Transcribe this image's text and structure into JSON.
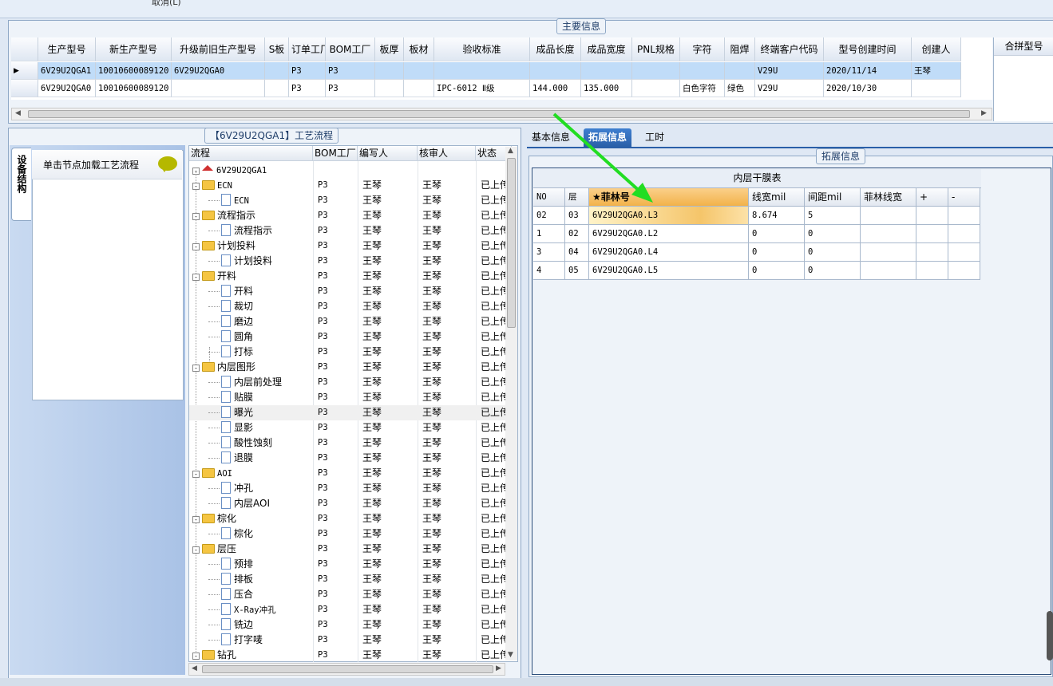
{
  "toolbar": {
    "cut_label": "取消(L)"
  },
  "main_info": {
    "title": "主要信息",
    "columns": [
      "生产型号",
      "新生产型号",
      "升级前旧生产型号",
      "S板",
      "订单工厂",
      "BOM工厂",
      "板厚",
      "板材",
      "验收标准",
      "成品长度",
      "成品宽度",
      "PNL规格",
      "字符",
      "阻焊",
      "终端客户代码",
      "型号创建时间",
      "创建人"
    ],
    "rows": [
      {
        "selected": true,
        "cells": [
          "6V29U2QGA1",
          "10010600089120",
          "6V29U2QGA0",
          "",
          "P3",
          "P3",
          "",
          "",
          "",
          "",
          "",
          "",
          "",
          "",
          "V29U",
          "2020/11/14",
          "王琴"
        ]
      },
      {
        "selected": false,
        "cells": [
          "6V29U2QGA0",
          "10010600089120",
          "",
          "",
          "P3",
          "P3",
          "",
          "",
          "IPC-6012 Ⅱ级",
          "144.000",
          "135.000",
          "",
          "白色字符",
          "绿色",
          "V29U",
          "2020/10/30",
          ""
        ]
      }
    ],
    "merge_title": "合拼型号"
  },
  "process": {
    "title": "【6V29U2QGA1】工艺流程",
    "side_tab": "设备结构",
    "hint": "单击节点加载工艺流程",
    "columns": [
      "流程",
      "BOM工厂",
      "编写人",
      "核审人",
      "状态"
    ],
    "root": "6V29U2QGA1",
    "rows": [
      {
        "name": "ECN",
        "level": 1,
        "type": "folder",
        "bom": "P3",
        "writer": "王琴",
        "reviewer": "王琴",
        "status": "已上传"
      },
      {
        "name": "ECN",
        "level": 2,
        "type": "doc",
        "bom": "P3",
        "writer": "王琴",
        "reviewer": "王琴",
        "status": "已上传"
      },
      {
        "name": "流程指示",
        "level": 1,
        "type": "folder",
        "bom": "P3",
        "writer": "王琴",
        "reviewer": "王琴",
        "status": "已上传"
      },
      {
        "name": "流程指示",
        "level": 2,
        "type": "doc",
        "bom": "P3",
        "writer": "王琴",
        "reviewer": "王琴",
        "status": "已上传"
      },
      {
        "name": "计划投料",
        "level": 1,
        "type": "folder",
        "bom": "P3",
        "writer": "王琴",
        "reviewer": "王琴",
        "status": "已上传"
      },
      {
        "name": "计划投料",
        "level": 2,
        "type": "doc",
        "bom": "P3",
        "writer": "王琴",
        "reviewer": "王琴",
        "status": "已上传"
      },
      {
        "name": "开料",
        "level": 1,
        "type": "folder",
        "bom": "P3",
        "writer": "王琴",
        "reviewer": "王琴",
        "status": "已上传"
      },
      {
        "name": "开料",
        "level": 2,
        "type": "doc",
        "bom": "P3",
        "writer": "王琴",
        "reviewer": "王琴",
        "status": "已上传"
      },
      {
        "name": "裁切",
        "level": 2,
        "type": "doc",
        "bom": "P3",
        "writer": "王琴",
        "reviewer": "王琴",
        "status": "已上传"
      },
      {
        "name": "磨边",
        "level": 2,
        "type": "doc",
        "bom": "P3",
        "writer": "王琴",
        "reviewer": "王琴",
        "status": "已上传"
      },
      {
        "name": "圆角",
        "level": 2,
        "type": "doc",
        "bom": "P3",
        "writer": "王琴",
        "reviewer": "王琴",
        "status": "已上传"
      },
      {
        "name": "打标",
        "level": 2,
        "type": "doc",
        "bom": "P3",
        "writer": "王琴",
        "reviewer": "王琴",
        "status": "已上传"
      },
      {
        "name": "内层图形",
        "level": 1,
        "type": "folder",
        "bom": "P3",
        "writer": "王琴",
        "reviewer": "王琴",
        "status": "已上传"
      },
      {
        "name": "内层前处理",
        "level": 2,
        "type": "doc",
        "bom": "P3",
        "writer": "王琴",
        "reviewer": "王琴",
        "status": "已上传"
      },
      {
        "name": "贴膜",
        "level": 2,
        "type": "doc",
        "bom": "P3",
        "writer": "王琴",
        "reviewer": "王琴",
        "status": "已上传"
      },
      {
        "name": "曝光",
        "level": 2,
        "type": "doc",
        "bom": "P3",
        "writer": "王琴",
        "reviewer": "王琴",
        "status": "已上传",
        "selected": true
      },
      {
        "name": "显影",
        "level": 2,
        "type": "doc",
        "bom": "P3",
        "writer": "王琴",
        "reviewer": "王琴",
        "status": "已上传"
      },
      {
        "name": "酸性蚀刻",
        "level": 2,
        "type": "doc",
        "bom": "P3",
        "writer": "王琴",
        "reviewer": "王琴",
        "status": "已上传"
      },
      {
        "name": "退膜",
        "level": 2,
        "type": "doc",
        "bom": "P3",
        "writer": "王琴",
        "reviewer": "王琴",
        "status": "已上传"
      },
      {
        "name": "AOI",
        "level": 1,
        "type": "folder",
        "bom": "P3",
        "writer": "王琴",
        "reviewer": "王琴",
        "status": "已上传"
      },
      {
        "name": "冲孔",
        "level": 2,
        "type": "doc",
        "bom": "P3",
        "writer": "王琴",
        "reviewer": "王琴",
        "status": "已上传"
      },
      {
        "name": "内层AOI",
        "level": 2,
        "type": "doc",
        "bom": "P3",
        "writer": "王琴",
        "reviewer": "王琴",
        "status": "已上传"
      },
      {
        "name": "棕化",
        "level": 1,
        "type": "folder",
        "bom": "P3",
        "writer": "王琴",
        "reviewer": "王琴",
        "status": "已上传"
      },
      {
        "name": "棕化",
        "level": 2,
        "type": "doc",
        "bom": "P3",
        "writer": "王琴",
        "reviewer": "王琴",
        "status": "已上传"
      },
      {
        "name": "层压",
        "level": 1,
        "type": "folder",
        "bom": "P3",
        "writer": "王琴",
        "reviewer": "王琴",
        "status": "已上传"
      },
      {
        "name": "预排",
        "level": 2,
        "type": "doc",
        "bom": "P3",
        "writer": "王琴",
        "reviewer": "王琴",
        "status": "已上传"
      },
      {
        "name": "排板",
        "level": 2,
        "type": "doc",
        "bom": "P3",
        "writer": "王琴",
        "reviewer": "王琴",
        "status": "已上传"
      },
      {
        "name": "压合",
        "level": 2,
        "type": "doc",
        "bom": "P3",
        "writer": "王琴",
        "reviewer": "王琴",
        "status": "已上传"
      },
      {
        "name": "X-Ray冲孔",
        "level": 2,
        "type": "doc",
        "bom": "P3",
        "writer": "王琴",
        "reviewer": "王琴",
        "status": "已上传"
      },
      {
        "name": "铣边",
        "level": 2,
        "type": "doc",
        "bom": "P3",
        "writer": "王琴",
        "reviewer": "王琴",
        "status": "已上传"
      },
      {
        "name": "打字唛",
        "level": 2,
        "type": "doc",
        "bom": "P3",
        "writer": "王琴",
        "reviewer": "王琴",
        "status": "已上传"
      },
      {
        "name": "钻孔",
        "level": 1,
        "type": "folder",
        "bom": "P3",
        "writer": "王琴",
        "reviewer": "王琴",
        "status": "已上传"
      }
    ]
  },
  "right": {
    "tabs": [
      "基本信息",
      "拓展信息",
      "工时"
    ],
    "active_tab": 1,
    "group_title": "拓展信息",
    "table_title": "内层干膜表",
    "columns": [
      "NO",
      "层",
      "★菲林号",
      "线宽mil",
      "间距mil",
      "菲林线宽",
      "+",
      "-"
    ],
    "rows": [
      [
        "02",
        "03",
        "6V29U2QGA0.L3",
        "8.674",
        "5",
        "",
        "",
        ""
      ],
      [
        "1",
        "02",
        "6V29U2QGA0.L2",
        "0",
        "0",
        "",
        "",
        ""
      ],
      [
        "3",
        "04",
        "6V29U2QGA0.L4",
        "0",
        "0",
        "",
        "",
        ""
      ],
      [
        "4",
        "05",
        "6V29U2QGA0.L5",
        "0",
        "0",
        "",
        "",
        ""
      ]
    ]
  },
  "colors": {
    "accent": "#2a5fa8",
    "selected_row": "#c0dcf8",
    "arrow": "#22dd22",
    "highlight": "#f5c56a"
  }
}
